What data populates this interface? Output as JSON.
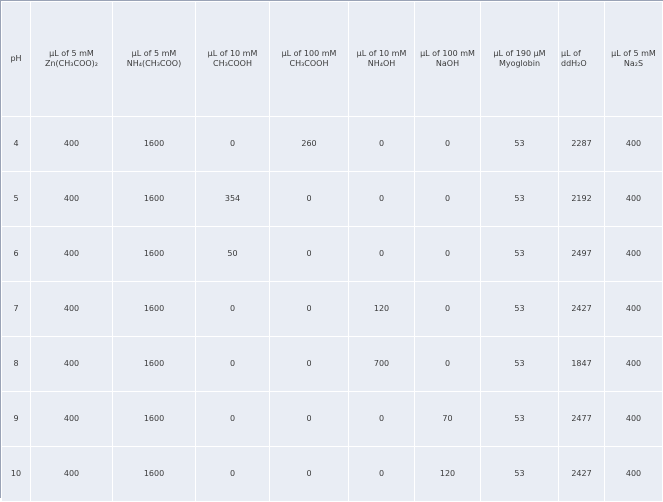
{
  "table": {
    "headers": [
      [
        "pH"
      ],
      [
        "µL of 5 mM",
        "Zn(CH₃COO)₂"
      ],
      [
        "µL of 5 mM",
        "NH₄(CH₃COO)"
      ],
      [
        "µL of 10 mM",
        "CH₃COOH"
      ],
      [
        "µL of 100 mM",
        "CH₃COOH"
      ],
      [
        "µL of 10 mM",
        "NH₄OH"
      ],
      [
        "µL of 100 mM",
        "NaOH"
      ],
      [
        "µL of 190 µM",
        "Myoglobin"
      ],
      [
        "µL of",
        "ddH₂O"
      ],
      [
        "µL of 5 mM",
        "Na₂S"
      ]
    ],
    "rows": [
      [
        "4",
        "400",
        "1600",
        "0",
        "260",
        "0",
        "0",
        "53",
        "2287",
        "400"
      ],
      [
        "5",
        "400",
        "1600",
        "354",
        "0",
        "0",
        "0",
        "53",
        "2192",
        "400"
      ],
      [
        "6",
        "400",
        "1600",
        "50",
        "0",
        "0",
        "0",
        "53",
        "2497",
        "400"
      ],
      [
        "7",
        "400",
        "1600",
        "0",
        "0",
        "120",
        "0",
        "53",
        "2427",
        "400"
      ],
      [
        "8",
        "400",
        "1600",
        "0",
        "0",
        "700",
        "0",
        "53",
        "1847",
        "400"
      ],
      [
        "9",
        "400",
        "1600",
        "0",
        "0",
        "0",
        "70",
        "53",
        "2477",
        "400"
      ],
      [
        "10",
        "400",
        "1600",
        "0",
        "0",
        "0",
        "120",
        "53",
        "2427",
        "400"
      ]
    ]
  },
  "colors": {
    "cell_background": "#e9edf4",
    "grid_lines": "#ffffff",
    "outer_border": "#9aa3b6",
    "text": "#3a3a3a"
  }
}
